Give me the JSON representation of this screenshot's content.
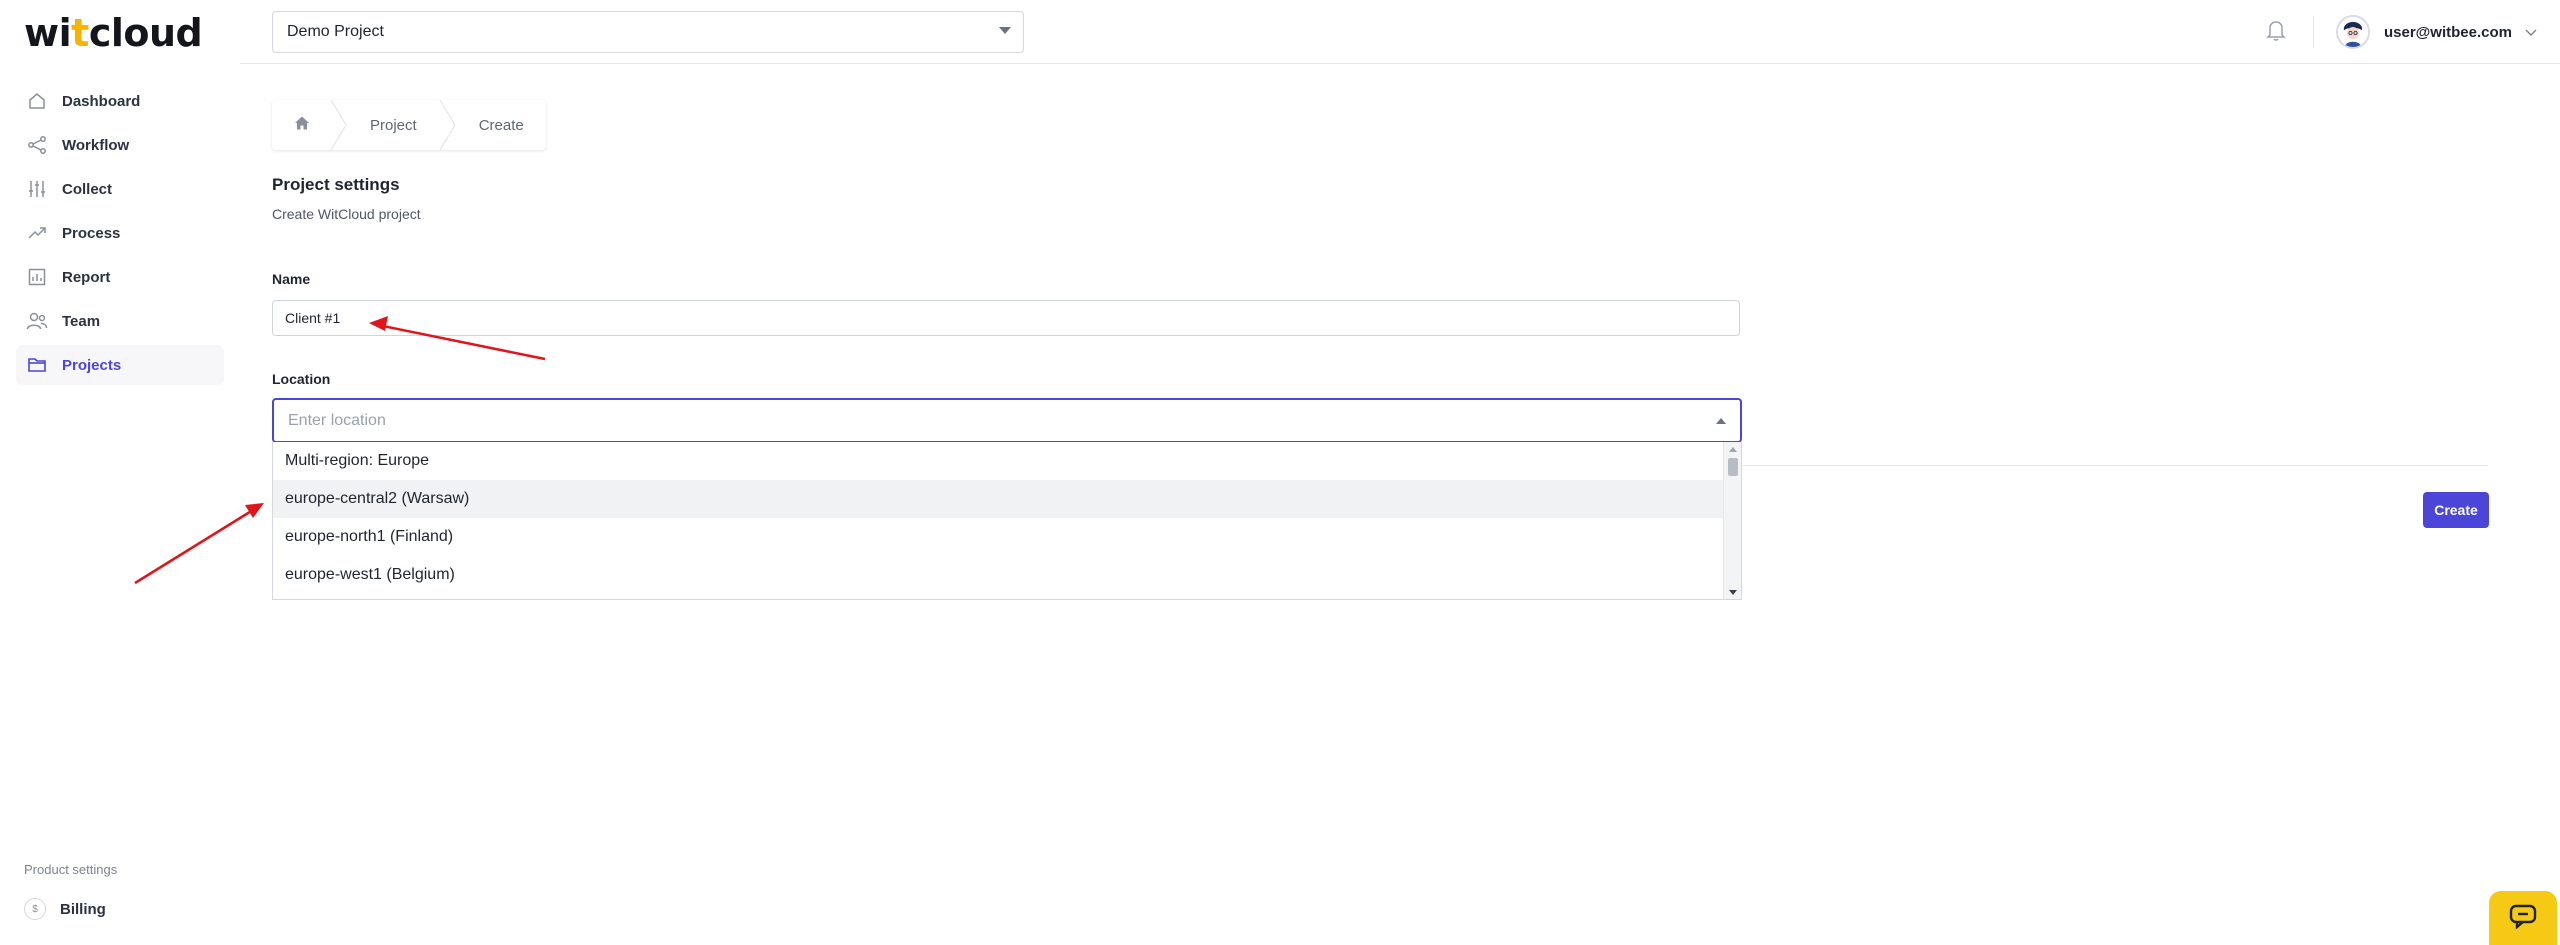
{
  "logo": {
    "part1": "wi",
    "slash": "t",
    "part2": "cloud"
  },
  "sidebar": {
    "items": [
      {
        "label": "Dashboard",
        "icon": "home-icon"
      },
      {
        "label": "Workflow",
        "icon": "share-icon"
      },
      {
        "label": "Collect",
        "icon": "sliders-icon"
      },
      {
        "label": "Process",
        "icon": "trend-icon"
      },
      {
        "label": "Report",
        "icon": "chart-icon"
      },
      {
        "label": "Team",
        "icon": "users-icon"
      },
      {
        "label": "Projects",
        "icon": "folder-icon",
        "active": true
      }
    ],
    "product_settings": "Product settings",
    "billing": {
      "label": "Billing",
      "icon_text": "$"
    }
  },
  "topbar": {
    "project_select": "Demo Project",
    "user_email": "user@witbee.com"
  },
  "breadcrumb": {
    "items": [
      "Project",
      "Create"
    ]
  },
  "main": {
    "title": "Project settings",
    "subtitle": "Create WitCloud project",
    "name_label": "Name",
    "name_value": "Client #1",
    "location_label": "Location",
    "location_placeholder": "Enter location",
    "location_options": [
      "Multi-region: Europe",
      "europe-central2 (Warsaw)",
      "europe-north1 (Finland)",
      "europe-west1 (Belgium)"
    ],
    "hovered_option": "europe-central2 (Warsaw)",
    "create_label": "Create"
  },
  "colors": {
    "accent": "#4b46d8",
    "logo_accent": "#f4b400",
    "annotation_arrow": "#e0151b",
    "chat_button": "#f6c915"
  }
}
